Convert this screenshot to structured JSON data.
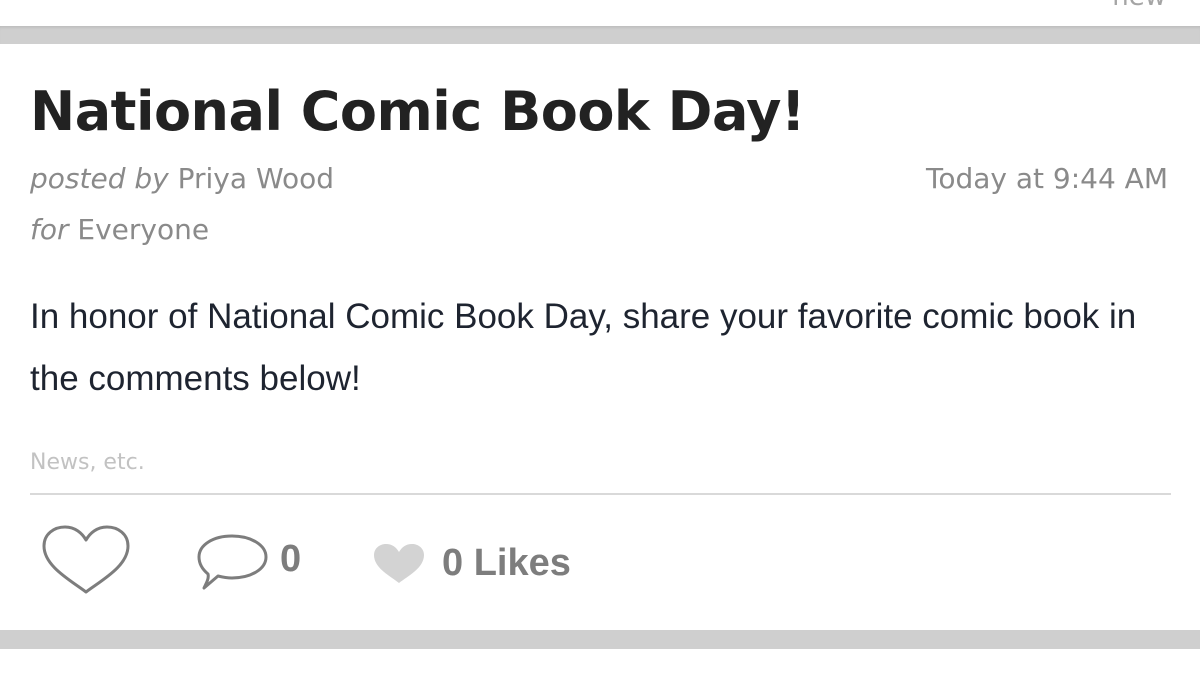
{
  "previous_card": {
    "cutoff_text": "new"
  },
  "post": {
    "title": "National Comic Book Day!",
    "posted_by_prefix": "posted by",
    "author": "Priya Wood",
    "for_prefix": "for",
    "audience": "Everyone",
    "timestamp": "Today at 9:44 AM",
    "body": "In honor of National Comic Book Day, share your favorite comic book in the comments below!",
    "category": "News, etc."
  },
  "actions": {
    "like_icon": "heart-outline-icon",
    "comment_icon": "speech-bubble-icon",
    "comment_count": "0",
    "likes_icon": "heart-filled-icon",
    "likes_label": "0 Likes"
  },
  "colors": {
    "separator": "#cfcfcf",
    "title": "#222222",
    "meta": "#8a8a8a",
    "body": "#1e2430",
    "muted": "#c2c2c2",
    "icon_gray": "#7d7d7d",
    "likes_heart": "#d3d3d3"
  }
}
